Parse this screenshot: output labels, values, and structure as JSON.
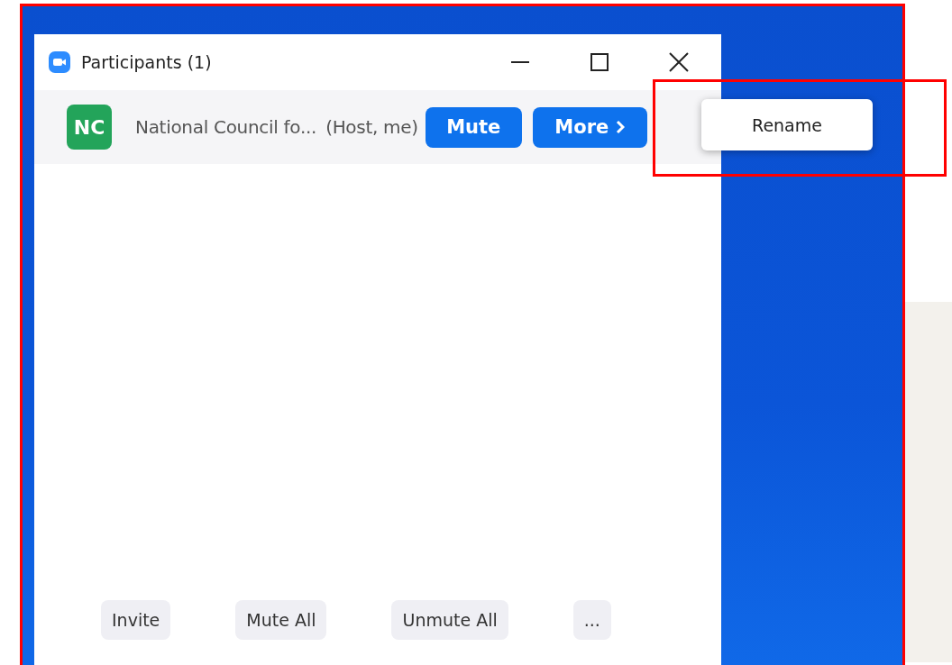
{
  "window": {
    "title": "Participants (1)"
  },
  "participants": [
    {
      "initials": "NC",
      "name": "National Council fo...",
      "role": "(Host, me)",
      "mute_label": "Mute",
      "more_label": "More"
    }
  ],
  "context_menu": {
    "items": [
      {
        "label": "Rename"
      }
    ]
  },
  "footer_buttons": [
    {
      "label": "Invite"
    },
    {
      "label": "Mute All"
    },
    {
      "label": "Unmute All"
    },
    {
      "label": "..."
    }
  ]
}
